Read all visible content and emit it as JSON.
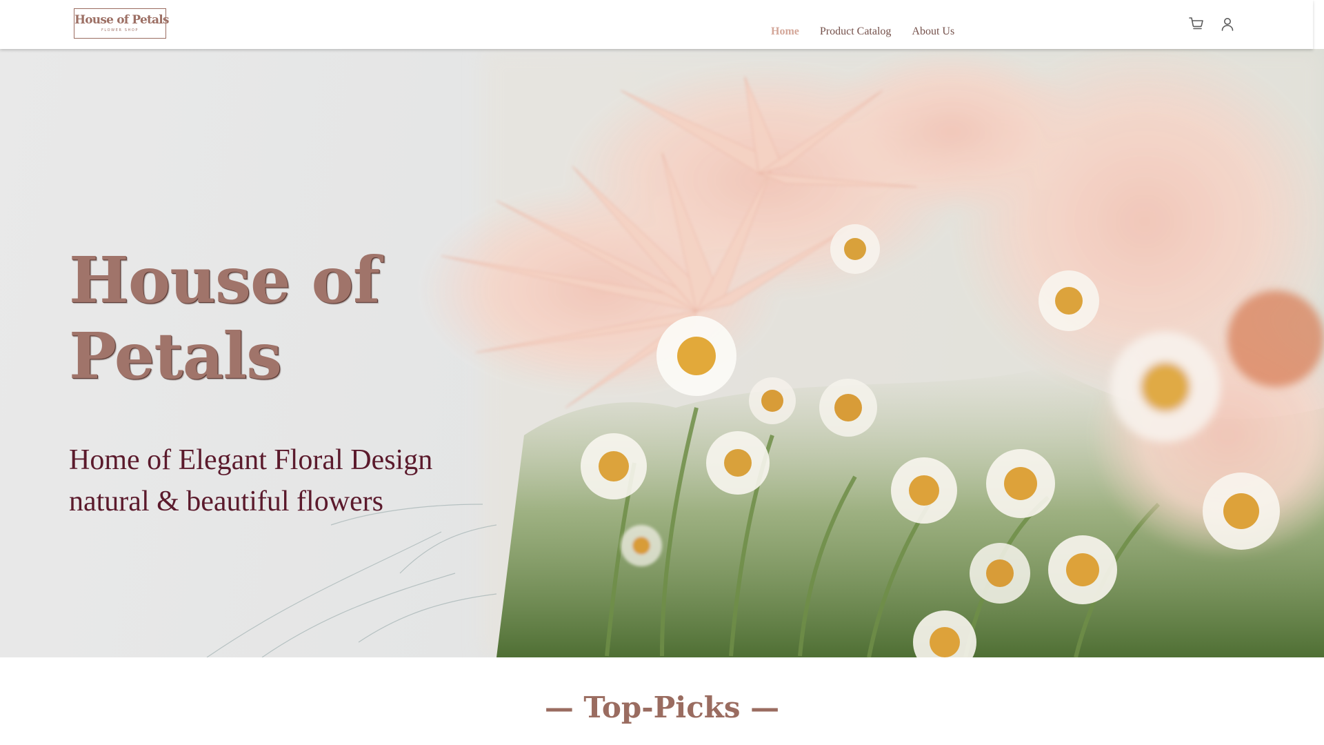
{
  "header": {
    "logo": {
      "title": "House of Petals",
      "subtitle": "FLOWER SHOP"
    },
    "nav": [
      {
        "label": "Home",
        "active": true
      },
      {
        "label": "Product Catalog",
        "active": false
      },
      {
        "label": "About Us",
        "active": false
      }
    ],
    "icons": {
      "cart": "cart-icon",
      "account": "user-icon"
    }
  },
  "hero": {
    "title": "House of Petals",
    "subtitle_line1": "Home of Elegant Floral Design",
    "subtitle_line2": "natural & beautiful flowers"
  },
  "sections": {
    "top_picks_heading": "— Top-Picks —"
  },
  "colors": {
    "brand": "#9c6f64",
    "nav_active": "#d3a698",
    "nav_text": "#74504a",
    "hero_subtitle": "#5b1a2c"
  }
}
